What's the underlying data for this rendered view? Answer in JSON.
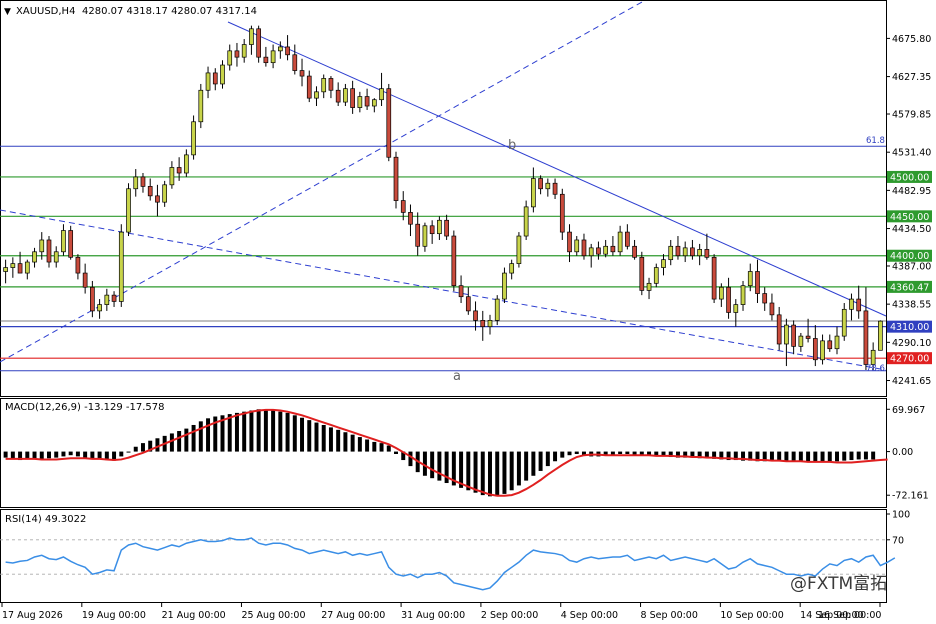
{
  "header": {
    "symbol": "XAUUSD,H4",
    "ohlc": "4280.07 4318.17 4280.07 4317.14",
    "menu_icon": "triangle-down-icon"
  },
  "colors": {
    "bull": "#c8d44a",
    "bear": "#c94b3c",
    "macd_hist": "#000000",
    "macd_signal": "#e02020",
    "rsi_line": "#3a8ee6",
    "support_green": "#2e9a2e",
    "resistance_red": "#e02020",
    "trend_blue": "#2e3fd0",
    "level_blue": "#3040c0"
  },
  "chart_data": [
    {
      "type": "candlestick",
      "title": "XAUUSD,H4",
      "ylim": [
        4222,
        4722
      ],
      "y_ticks": [
        "4675.80",
        "4627.35",
        "4579.85",
        "4531.40",
        "4482.95",
        "4434.50",
        "4387.00",
        "4338.55",
        "4290.10",
        "4241.65"
      ],
      "x_ticks": [
        "17 Aug 2026",
        "19 Aug 00:00",
        "21 Aug 00:00",
        "25 Aug 00:00",
        "27 Aug 00:00",
        "31 Aug 00:00",
        "2 Sep 00:00",
        "4 Sep 00:00",
        "8 Sep 00:00",
        "10 Sep 00:00",
        "14 Sep 00:00",
        "16 Sep 00:00"
      ],
      "current_price": "4317.14",
      "horizontal_levels": [
        {
          "label": "4500.00",
          "value": 4500,
          "color": "green"
        },
        {
          "label": "4450.00",
          "value": 4450,
          "color": "green"
        },
        {
          "label": "4400.00",
          "value": 4400,
          "color": "green"
        },
        {
          "label": "4360.47",
          "value": 4360.47,
          "color": "green"
        },
        {
          "label": "4310.00",
          "value": 4310,
          "color": "blue"
        },
        {
          "label": "4270.00",
          "value": 4270,
          "color": "red"
        }
      ],
      "fib_labels": [
        {
          "label": "61.8",
          "value": 4539
        },
        {
          "label": "78.6",
          "value": 4254
        }
      ],
      "wave_labels": [
        {
          "label": "b",
          "value": 4540
        },
        {
          "label": "a",
          "value": 4248
        }
      ],
      "candles": [
        [
          4380,
          4395,
          4365,
          4385
        ],
        [
          4385,
          4398,
          4372,
          4390
        ],
        [
          4390,
          4405,
          4380,
          4378
        ],
        [
          4378,
          4395,
          4370,
          4392
        ],
        [
          4392,
          4410,
          4385,
          4405
        ],
        [
          4405,
          4430,
          4395,
          4420
        ],
        [
          4420,
          4425,
          4385,
          4392
        ],
        [
          4392,
          4412,
          4385,
          4405
        ],
        [
          4405,
          4440,
          4400,
          4432
        ],
        [
          4432,
          4438,
          4395,
          4398
        ],
        [
          4398,
          4402,
          4370,
          4378
        ],
        [
          4378,
          4390,
          4352,
          4360
        ],
        [
          4360,
          4368,
          4322,
          4330
        ],
        [
          4330,
          4345,
          4320,
          4338
        ],
        [
          4338,
          4358,
          4330,
          4350
        ],
        [
          4350,
          4355,
          4335,
          4342
        ],
        [
          4342,
          4440,
          4335,
          4430
        ],
        [
          4430,
          4492,
          4425,
          4485
        ],
        [
          4485,
          4510,
          4475,
          4500
        ],
        [
          4500,
          4505,
          4480,
          4488
        ],
        [
          4488,
          4498,
          4470,
          4476
        ],
        [
          4476,
          4490,
          4450,
          4468
        ],
        [
          4468,
          4495,
          4462,
          4490
        ],
        [
          4490,
          4520,
          4485,
          4512
        ],
        [
          4512,
          4525,
          4495,
          4505
        ],
        [
          4505,
          4535,
          4500,
          4528
        ],
        [
          4528,
          4578,
          4522,
          4570
        ],
        [
          4570,
          4618,
          4562,
          4610
        ],
        [
          4610,
          4640,
          4600,
          4632
        ],
        [
          4632,
          4638,
          4610,
          4618
        ],
        [
          4618,
          4648,
          4612,
          4642
        ],
        [
          4642,
          4668,
          4635,
          4660
        ],
        [
          4660,
          4670,
          4640,
          4652
        ],
        [
          4652,
          4675,
          4645,
          4668
        ],
        [
          4668,
          4692,
          4655,
          4688
        ],
        [
          4688,
          4692,
          4645,
          4652
        ],
        [
          4652,
          4665,
          4640,
          4645
        ],
        [
          4645,
          4668,
          4638,
          4660
        ],
        [
          4660,
          4672,
          4650,
          4665
        ],
        [
          4665,
          4680,
          4648,
          4655
        ],
        [
          4655,
          4668,
          4630,
          4635
        ],
        [
          4635,
          4650,
          4615,
          4628
        ],
        [
          4628,
          4635,
          4595,
          4600
        ],
        [
          4600,
          4615,
          4590,
          4608
        ],
        [
          4608,
          4630,
          4600,
          4625
        ],
        [
          4625,
          4628,
          4600,
          4610
        ],
        [
          4610,
          4620,
          4590,
          4595
        ],
        [
          4595,
          4618,
          4590,
          4612
        ],
        [
          4612,
          4622,
          4580,
          4588
        ],
        [
          4588,
          4608,
          4582,
          4602
        ],
        [
          4602,
          4612,
          4585,
          4590
        ],
        [
          4590,
          4600,
          4582,
          4598
        ],
        [
          4598,
          4632,
          4590,
          4612
        ],
        [
          4612,
          4618,
          4520,
          4525
        ],
        [
          4525,
          4532,
          4460,
          4470
        ],
        [
          4470,
          4482,
          4445,
          4455
        ],
        [
          4455,
          4465,
          4425,
          4440
        ],
        [
          4440,
          4455,
          4400,
          4412
        ],
        [
          4412,
          4442,
          4405,
          4438
        ],
        [
          4438,
          4445,
          4415,
          4428
        ],
        [
          4428,
          4450,
          4420,
          4445
        ],
        [
          4445,
          4452,
          4420,
          4425
        ],
        [
          4425,
          4432,
          4355,
          4362
        ],
        [
          4362,
          4375,
          4340,
          4348
        ],
        [
          4348,
          4360,
          4325,
          4330
        ],
        [
          4330,
          4342,
          4305,
          4318
        ],
        [
          4318,
          4330,
          4292,
          4310
        ],
        [
          4310,
          4325,
          4300,
          4318
        ],
        [
          4318,
          4350,
          4312,
          4345
        ],
        [
          4345,
          4385,
          4340,
          4378
        ],
        [
          4378,
          4395,
          4370,
          4390
        ],
        [
          4390,
          4430,
          4385,
          4425
        ],
        [
          4425,
          4470,
          4420,
          4462
        ],
        [
          4462,
          4512,
          4455,
          4498
        ],
        [
          4498,
          4502,
          4478,
          4485
        ],
        [
          4485,
          4498,
          4475,
          4492
        ],
        [
          4492,
          4498,
          4472,
          4478
        ],
        [
          4478,
          4485,
          4420,
          4430
        ],
        [
          4430,
          4440,
          4392,
          4405
        ],
        [
          4405,
          4425,
          4400,
          4420
        ],
        [
          4420,
          4428,
          4395,
          4400
        ],
        [
          4400,
          4415,
          4385,
          4410
        ],
        [
          4410,
          4418,
          4395,
          4402
        ],
        [
          4402,
          4420,
          4398,
          4412
        ],
        [
          4412,
          4425,
          4400,
          4405
        ],
        [
          4405,
          4438,
          4400,
          4430
        ],
        [
          4430,
          4440,
          4408,
          4412
        ],
        [
          4412,
          4420,
          4395,
          4398
        ],
        [
          4398,
          4405,
          4350,
          4356
        ],
        [
          4356,
          4372,
          4345,
          4365
        ],
        [
          4365,
          4390,
          4360,
          4385
        ],
        [
          4385,
          4402,
          4375,
          4395
        ],
        [
          4395,
          4420,
          4388,
          4412
        ],
        [
          4412,
          4425,
          4395,
          4400
        ],
        [
          4400,
          4418,
          4392,
          4410
        ],
        [
          4410,
          4420,
          4395,
          4400
        ],
        [
          4400,
          4415,
          4388,
          4408
        ],
        [
          4408,
          4428,
          4395,
          4398
        ],
        [
          4398,
          4402,
          4340,
          4345
        ],
        [
          4345,
          4365,
          4335,
          4360
        ],
        [
          4360,
          4372,
          4320,
          4328
        ],
        [
          4328,
          4345,
          4310,
          4338
        ],
        [
          4338,
          4368,
          4330,
          4362
        ],
        [
          4362,
          4390,
          4355,
          4380
        ],
        [
          4380,
          4395,
          4340,
          4352
        ],
        [
          4352,
          4360,
          4330,
          4340
        ],
        [
          4340,
          4352,
          4318,
          4325
        ],
        [
          4325,
          4335,
          4280,
          4288
        ],
        [
          4288,
          4320,
          4260,
          4312
        ],
        [
          4312,
          4318,
          4275,
          4285
        ],
        [
          4285,
          4302,
          4278,
          4298
        ],
        [
          4298,
          4320,
          4290,
          4295
        ],
        [
          4295,
          4312,
          4260,
          4268
        ],
        [
          4268,
          4300,
          4262,
          4292
        ],
        [
          4292,
          4300,
          4278,
          4282
        ],
        [
          4282,
          4310,
          4275,
          4298
        ],
        [
          4298,
          4340,
          4292,
          4332
        ],
        [
          4332,
          4352,
          4318,
          4345
        ],
        [
          4345,
          4362,
          4320,
          4330
        ],
        [
          4330,
          4360,
          4255,
          4262
        ],
        [
          4262,
          4290,
          4255,
          4280
        ],
        [
          4280,
          4318,
          4280,
          4317
        ]
      ]
    },
    {
      "type": "histogram-line",
      "title": "MACD(12,26,9)",
      "readout": "MACD(12,26,9) -13.129 -17.578",
      "ylim": [
        -90,
        82
      ],
      "y_ticks": [
        "69.967",
        "0.00",
        "-72.161"
      ],
      "macd_histogram": [
        -10,
        -12,
        -14,
        -13,
        -12,
        -14,
        -11,
        -10,
        -8,
        -6,
        -8,
        -10,
        -12,
        -13,
        -14,
        -15,
        -8,
        0,
        8,
        14,
        18,
        22,
        26,
        30,
        34,
        38,
        44,
        50,
        55,
        58,
        60,
        62,
        64,
        66,
        68,
        70,
        70,
        68,
        66,
        64,
        60,
        56,
        52,
        48,
        44,
        40,
        36,
        32,
        28,
        24,
        20,
        16,
        14,
        10,
        -4,
        -14,
        -24,
        -34,
        -40,
        -44,
        -48,
        -52,
        -56,
        -60,
        -64,
        -68,
        -72,
        -74,
        -74,
        -70,
        -64,
        -56,
        -48,
        -40,
        -32,
        -24,
        -16,
        -10,
        -6,
        -4,
        -6,
        -8,
        -8,
        -6,
        -5,
        -4,
        -4,
        -5,
        -6,
        -7,
        -8,
        -8,
        -9,
        -10,
        -10,
        -10,
        -11,
        -11,
        -12,
        -13,
        -14,
        -14,
        -15,
        -15,
        -16,
        -16,
        -16,
        -16,
        -16,
        -17,
        -17,
        -16,
        -16,
        -17,
        -17,
        -16,
        -15,
        -14,
        -13,
        -13,
        -13
      ],
      "signal": [
        -12,
        -12,
        -12,
        -12,
        -12,
        -13,
        -13,
        -13,
        -12,
        -11,
        -11,
        -11,
        -12,
        -12,
        -13,
        -14,
        -13,
        -10,
        -6,
        -2,
        3,
        8,
        13,
        18,
        23,
        28,
        33,
        38,
        43,
        48,
        52,
        56,
        60,
        63,
        66,
        68,
        69,
        69,
        68,
        66,
        63,
        60,
        56,
        52,
        48,
        44,
        40,
        36,
        32,
        28,
        24,
        20,
        16,
        12,
        6,
        -1,
        -8,
        -16,
        -23,
        -30,
        -36,
        -42,
        -48,
        -53,
        -58,
        -63,
        -67,
        -71,
        -73,
        -73,
        -72,
        -68,
        -62,
        -55,
        -47,
        -38,
        -30,
        -22,
        -15,
        -9,
        -6,
        -5,
        -5,
        -6,
        -6,
        -6,
        -6,
        -6,
        -6,
        -6,
        -7,
        -7,
        -7,
        -8,
        -8,
        -9,
        -9,
        -10,
        -10,
        -11,
        -11,
        -12,
        -12,
        -13,
        -14,
        -14,
        -15,
        -15,
        -16,
        -16,
        -16,
        -17,
        -17,
        -17,
        -17,
        -18,
        -18,
        -18,
        -17,
        -16,
        -15,
        -14,
        -13
      ]
    },
    {
      "type": "line",
      "title": "RSI(14)",
      "readout": "RSI(14) 49.3022",
      "ylim": [
        0,
        100
      ],
      "y_ticks": [
        "100",
        "70",
        "30",
        "0"
      ],
      "levels": [
        70,
        30
      ],
      "values": [
        44,
        43,
        45,
        46,
        50,
        52,
        48,
        47,
        50,
        45,
        41,
        38,
        30,
        32,
        35,
        34,
        58,
        64,
        66,
        62,
        60,
        58,
        61,
        64,
        62,
        66,
        68,
        70,
        68,
        68,
        69,
        72,
        70,
        70,
        72,
        66,
        64,
        66,
        66,
        64,
        60,
        58,
        54,
        56,
        58,
        56,
        54,
        56,
        52,
        54,
        52,
        54,
        56,
        38,
        30,
        28,
        30,
        26,
        30,
        30,
        32,
        28,
        20,
        18,
        16,
        14,
        12,
        14,
        22,
        32,
        38,
        44,
        52,
        58,
        56,
        55,
        54,
        52,
        46,
        44,
        48,
        50,
        48,
        49,
        50,
        50,
        52,
        46,
        48,
        50,
        48,
        52,
        46,
        48,
        50,
        48,
        46,
        44,
        48,
        42,
        36,
        38,
        44,
        48,
        42,
        40,
        38,
        34,
        30,
        30,
        28,
        30,
        28,
        36,
        42,
        40,
        46,
        48,
        44,
        50,
        52,
        40,
        44,
        49
      ]
    }
  ],
  "watermark": "@FXTM富拓"
}
